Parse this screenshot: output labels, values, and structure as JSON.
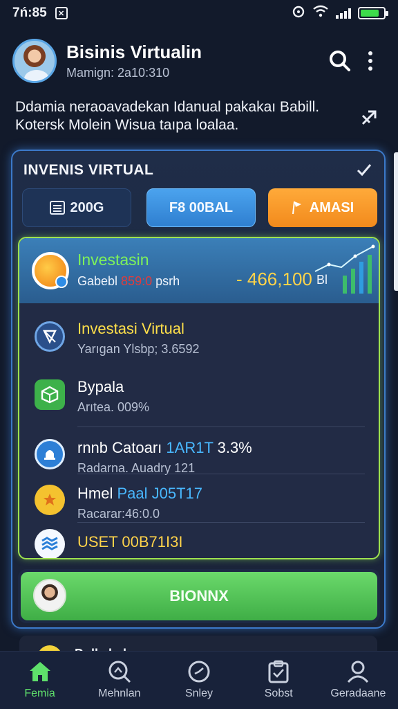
{
  "status_bar": {
    "time": "7ń:85",
    "battery_icon": "battery-icon",
    "wifi_icon": "wifi-icon"
  },
  "header": {
    "title": "Bisinis Virtualin",
    "subtitle": "Mamign: 2a10:310"
  },
  "description": {
    "line1": "Ddamia neraoavadekan Idanual pakakaı Babill.",
    "line2": "Kotersk Molein Wisua taıpa loalaa."
  },
  "panel": {
    "title": "INVENIS VIRTUAL",
    "buttons": {
      "balance_label": "200G",
      "global_label": "F8 00BAL",
      "amasi_label": "AMASI"
    }
  },
  "hero": {
    "title": "Investasin",
    "sub_prefix": "Gabebl ",
    "sub_highlight": "859:0",
    "sub_suffix": " psrh",
    "value": "- 466,100",
    "unit": "Bl"
  },
  "items": [
    {
      "title": "Investasi Virtual",
      "subtitle": "Yarıgan Ylsbp; 3.6592",
      "title_color": "#ffe04a",
      "icon": "shield-icon"
    },
    {
      "title": "Bypala",
      "subtitle": "Arıtea. 009%",
      "title_color": "#ffffff",
      "icon": "cube-icon"
    },
    {
      "title_part1": "rnnb Catoarı ",
      "title_part2": "1AR1T",
      "title_part3": " 3.3%",
      "subtitle": "Radarna. Auadry 121",
      "icon": "bell-icon"
    },
    {
      "title_part1": "Hmel ",
      "title_part2": "Paal J05T17",
      "subtitle": "Racarar:46:0.0",
      "icon": "star-icon"
    },
    {
      "title": "USET 00B71I3I",
      "icon": "wave-icon"
    }
  ],
  "cta": {
    "label": "BIONNX"
  },
  "peek": {
    "text": "Dolla bab"
  },
  "nav": [
    {
      "label": "Femia",
      "icon": "home-icon",
      "active": true
    },
    {
      "label": "Mehnlan",
      "icon": "search-icon",
      "active": false
    },
    {
      "label": "Snley",
      "icon": "clock-icon",
      "active": false
    },
    {
      "label": "Sobst",
      "icon": "clipboard-icon",
      "active": false
    },
    {
      "label": "Geradaane",
      "icon": "user-icon",
      "active": false
    }
  ],
  "colors": {
    "background": "#121a2b",
    "accent_green": "#5fe06b",
    "accent_yellow": "#ffd34a",
    "accent_blue": "#4ba3ee",
    "accent_orange": "#f28a1c"
  }
}
